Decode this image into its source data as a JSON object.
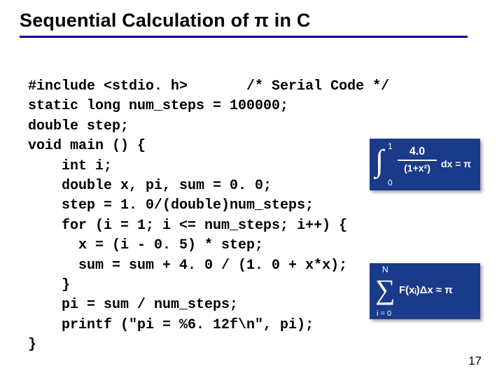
{
  "slide": {
    "title": "Sequential Calculation of π in C",
    "page_number": "17"
  },
  "code": {
    "l1": "#include <stdio. h>       /* Serial Code */",
    "l2": "static long num_steps = 100000;",
    "l3": "double step;",
    "l4": "void main () {",
    "l5": "    int i;",
    "l6": "    double x, pi, sum = 0. 0;",
    "l7": "    step = 1. 0/(double)num_steps;",
    "l8": "    for (i = 1; i <= num_steps; i++) {",
    "l9": "      x = (i - 0. 5) * step;",
    "l10": "      sum = sum + 4. 0 / (1. 0 + x*x);",
    "l11": "    }",
    "l12": "    pi = sum / num_steps;",
    "l13": "    printf (\"pi = %6. 12f\\n\", pi);",
    "l14": "}"
  },
  "formula1": {
    "upper": "1",
    "lower": "0",
    "numerator": "4.0",
    "denominator": "(1+x²)",
    "tail": "dx = π"
  },
  "formula2": {
    "upper": "N",
    "lower": "i = 0",
    "body": "F(xᵢ)Δx ≈ π"
  }
}
